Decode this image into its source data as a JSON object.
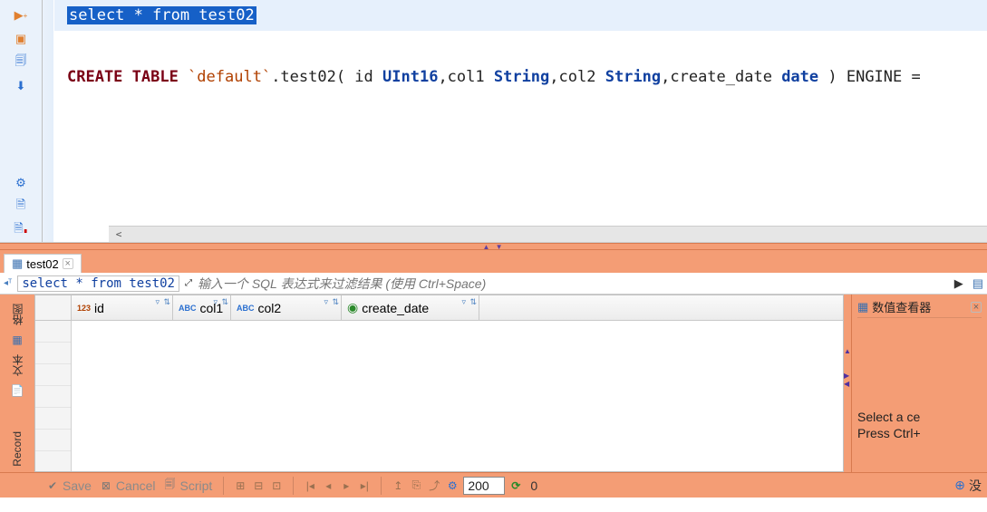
{
  "editor": {
    "line1_selected": "select  * from  test02",
    "line3": {
      "t1": "CREATE TABLE ",
      "t2": "`default`",
      "t3": ".test02( id ",
      "t4": "UInt16",
      "t5": ",col1 ",
      "t6": "String",
      "t7": ",col2 ",
      "t8": "String",
      "t9": ",create_date ",
      "t10": "date",
      "t11": " ) ENGINE ="
    }
  },
  "result_tab": {
    "label": "test02"
  },
  "filter": {
    "query": "select * from test02",
    "placeholder": "输入一个 SQL 表达式来过滤结果 (使用 Ctrl+Space)"
  },
  "columns": {
    "c1": {
      "badge": "123",
      "name": "id"
    },
    "c2": {
      "badge": "ABC",
      "name": "col1"
    },
    "c3": {
      "badge": "ABC",
      "name": "col2"
    },
    "c4": {
      "name": "create_date"
    }
  },
  "vtabs": {
    "t1": "格图",
    "t2": "文本",
    "t3": "Record"
  },
  "sidepanel": {
    "title": "数值查看器",
    "line1": "Select a ce",
    "line2": "Press Ctrl+"
  },
  "status": {
    "save": "Save",
    "cancel": "Cancel",
    "script": "Script",
    "page_size": "200",
    "row_count": "0",
    "right_text": "没"
  }
}
